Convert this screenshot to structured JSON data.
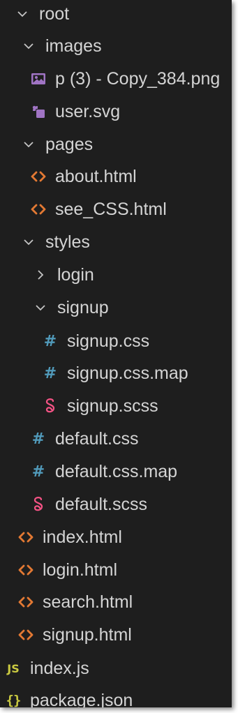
{
  "explorer": {
    "root": {
      "label": "root",
      "icon": "chevron-down-icon"
    },
    "items": [
      {
        "label": "images",
        "icon": "chevron-down-icon",
        "kind": "folder"
      },
      {
        "label": "p (3) - Copy_384.png",
        "icon": "image-file-icon",
        "kind": "file"
      },
      {
        "label": "user.svg",
        "icon": "svg-file-icon",
        "kind": "file"
      },
      {
        "label": "pages",
        "icon": "chevron-down-icon",
        "kind": "folder"
      },
      {
        "label": "about.html",
        "icon": "html-file-icon",
        "kind": "file"
      },
      {
        "label": "see_CSS.html",
        "icon": "html-file-icon",
        "kind": "file"
      },
      {
        "label": "styles",
        "icon": "chevron-down-icon",
        "kind": "folder"
      },
      {
        "label": "login",
        "icon": "chevron-right-icon",
        "kind": "folder"
      },
      {
        "label": "signup",
        "icon": "chevron-down-icon",
        "kind": "folder"
      },
      {
        "label": "signup.css",
        "icon": "css-file-icon",
        "kind": "file"
      },
      {
        "label": "signup.css.map",
        "icon": "css-file-icon",
        "kind": "file"
      },
      {
        "label": "signup.scss",
        "icon": "sass-file-icon",
        "kind": "file"
      },
      {
        "label": "default.css",
        "icon": "css-file-icon",
        "kind": "file"
      },
      {
        "label": "default.css.map",
        "icon": "css-file-icon",
        "kind": "file"
      },
      {
        "label": "default.scss",
        "icon": "sass-file-icon",
        "kind": "file"
      },
      {
        "label": "index.html",
        "icon": "html-file-icon",
        "kind": "file"
      },
      {
        "label": "login.html",
        "icon": "html-file-icon",
        "kind": "file"
      },
      {
        "label": "search.html",
        "icon": "html-file-icon",
        "kind": "file"
      },
      {
        "label": "signup.html",
        "icon": "html-file-icon",
        "kind": "file"
      },
      {
        "label": "index.js",
        "icon": "js-file-icon",
        "kind": "file"
      },
      {
        "label": "package.json",
        "icon": "json-file-icon",
        "kind": "file"
      }
    ],
    "glyphs": {
      "css": "#",
      "json": "{}",
      "js": "JS"
    },
    "colors": {
      "background": "#1e1e1e",
      "text": "#d4d4d4",
      "chevron": "#c5c5c5",
      "html": "#e37933",
      "css": "#519aba",
      "sass": "#f55385",
      "image": "#a074c4",
      "json": "#cbcb41",
      "js": "#cbcb41"
    }
  }
}
